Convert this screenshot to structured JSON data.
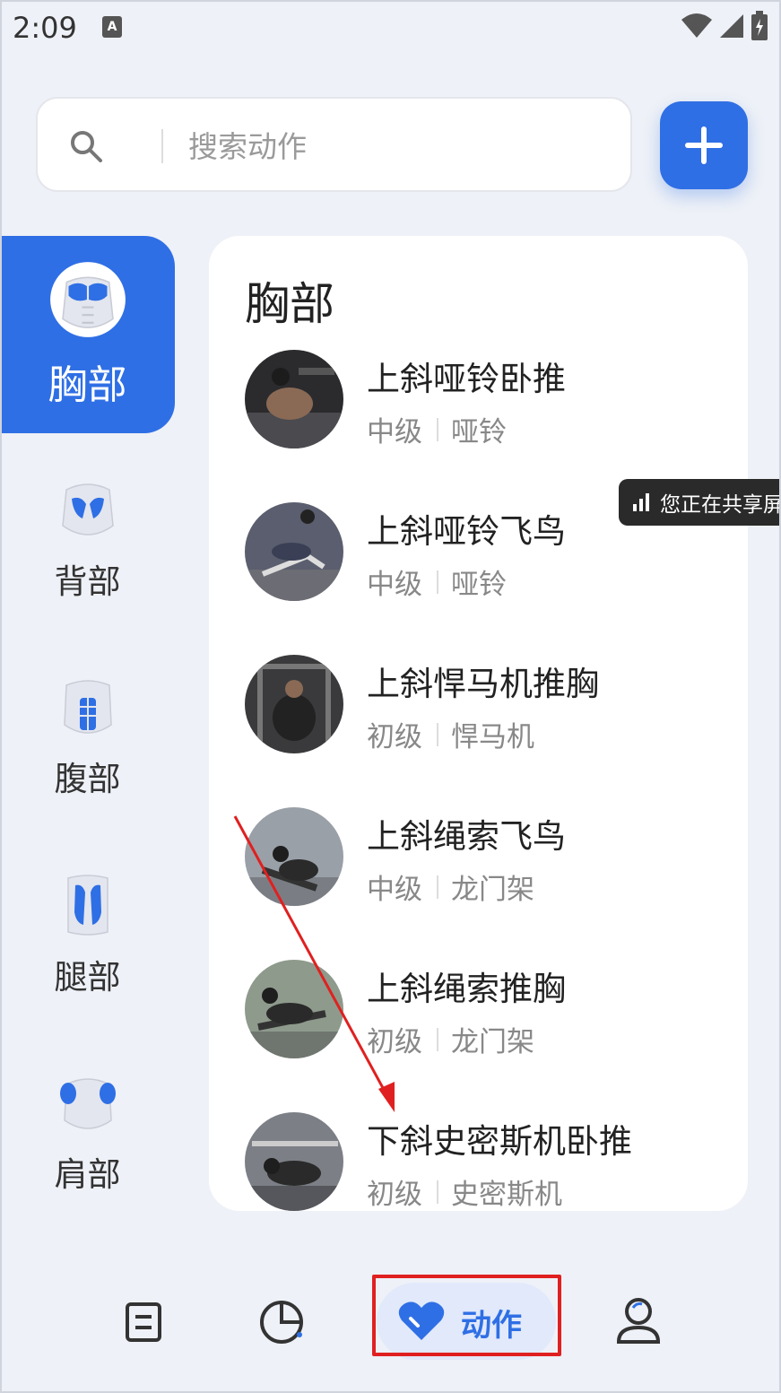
{
  "status_bar": {
    "time": "2:09",
    "notification_badge": "A"
  },
  "search": {
    "placeholder": "搜索动作",
    "value": ""
  },
  "add_button": {
    "icon": "plus-icon"
  },
  "sidebar": {
    "items": [
      {
        "label": "胸部",
        "icon": "chest-muscle-icon",
        "active": true
      },
      {
        "label": "背部",
        "icon": "back-muscle-icon",
        "active": false
      },
      {
        "label": "腹部",
        "icon": "abs-muscle-icon",
        "active": false
      },
      {
        "label": "腿部",
        "icon": "legs-muscle-icon",
        "active": false
      },
      {
        "label": "肩部",
        "icon": "shoulder-muscle-icon",
        "active": false
      }
    ]
  },
  "content": {
    "section_title": "胸部",
    "exercises": [
      {
        "name": "上斜哑铃卧推",
        "level": "中级",
        "equipment": "哑铃"
      },
      {
        "name": "上斜哑铃飞鸟",
        "level": "中级",
        "equipment": "哑铃"
      },
      {
        "name": "上斜悍马机推胸",
        "level": "初级",
        "equipment": "悍马机"
      },
      {
        "name": "上斜绳索飞鸟",
        "level": "中级",
        "equipment": "龙门架"
      },
      {
        "name": "上斜绳索推胸",
        "level": "初级",
        "equipment": "龙门架"
      },
      {
        "name": "下斜史密斯机卧推",
        "level": "初级",
        "equipment": "史密斯机"
      }
    ]
  },
  "share_toast": {
    "text": "您正在共享屏"
  },
  "bottom_nav": {
    "items": [
      {
        "icon": "plan-list-icon",
        "label": ""
      },
      {
        "icon": "stats-pie-icon",
        "label": ""
      },
      {
        "icon": "heart-icon",
        "label": "动作",
        "active": true
      },
      {
        "icon": "profile-icon",
        "label": ""
      }
    ]
  },
  "colors": {
    "accent": "#2f6fe5",
    "background": "#eef1f7",
    "annotation": "#e02020"
  }
}
